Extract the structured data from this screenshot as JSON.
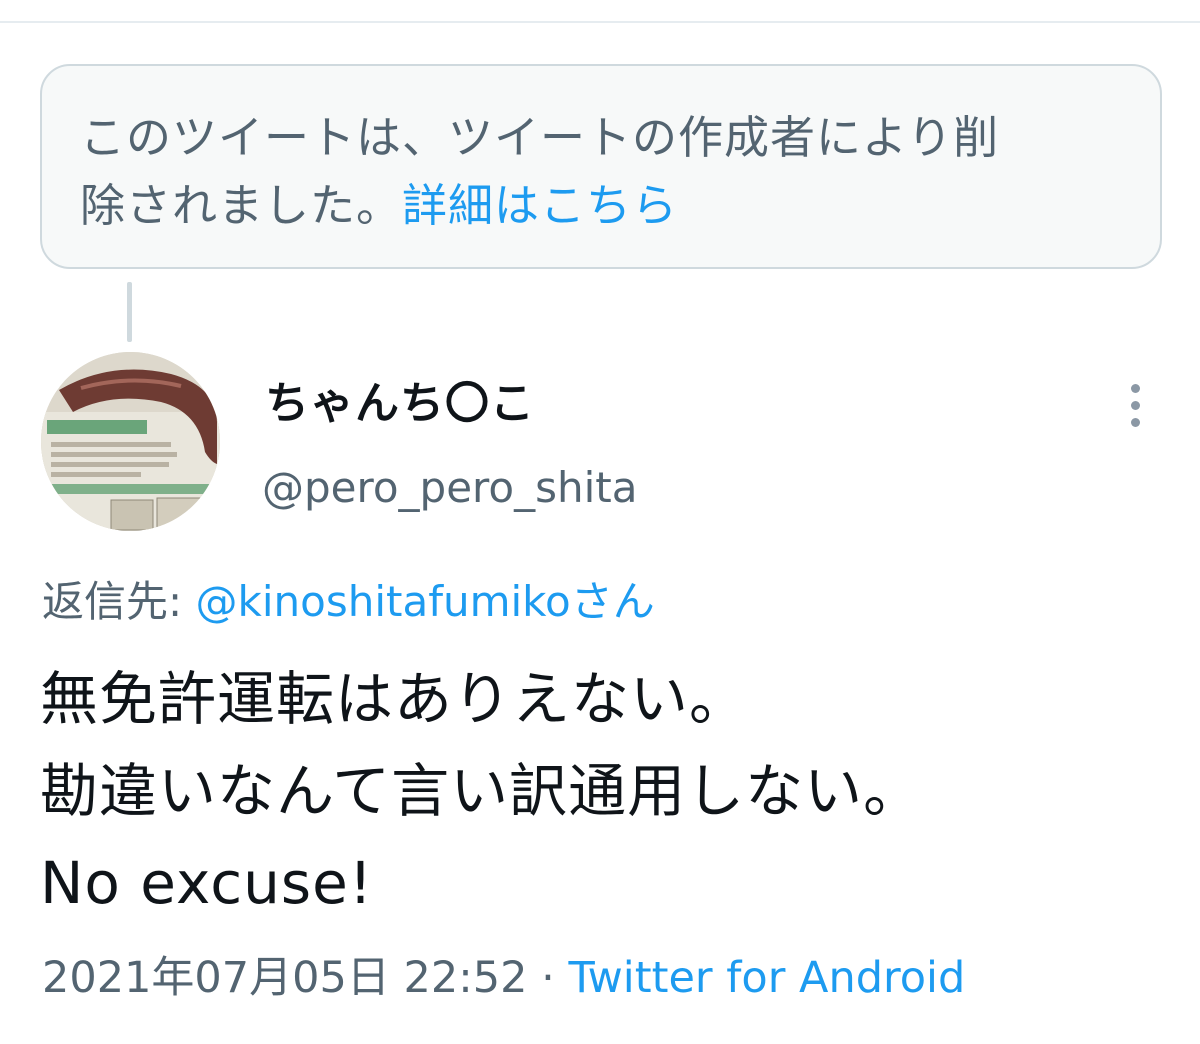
{
  "deleted_notice": {
    "line1": "このツイートは、ツイートの作成者により削",
    "line2": "除されました。",
    "link": "詳細はこちら"
  },
  "tweet": {
    "author": {
      "display_name": "ちゃんち〇こ",
      "handle": "@pero_pero_shita",
      "avatar_icon": "avatar-image"
    },
    "reply_label": "返信先: ",
    "reply_to": "@kinoshitafumikoさん",
    "text_lines": [
      "無免許運転はありえない。",
      "勘違いなんて言い訳通用しない。",
      "No excuse!"
    ],
    "timestamp": "2021年07月05日 22:52",
    "separator": " · ",
    "source": "Twitter for Android",
    "more_icon": "more-vertical-icon"
  },
  "colors": {
    "link": "#1d9bf0",
    "secondary_text": "#536471",
    "primary_text": "#0f1419",
    "box_border": "#cfd9de",
    "box_bg": "#f7f9f9"
  }
}
